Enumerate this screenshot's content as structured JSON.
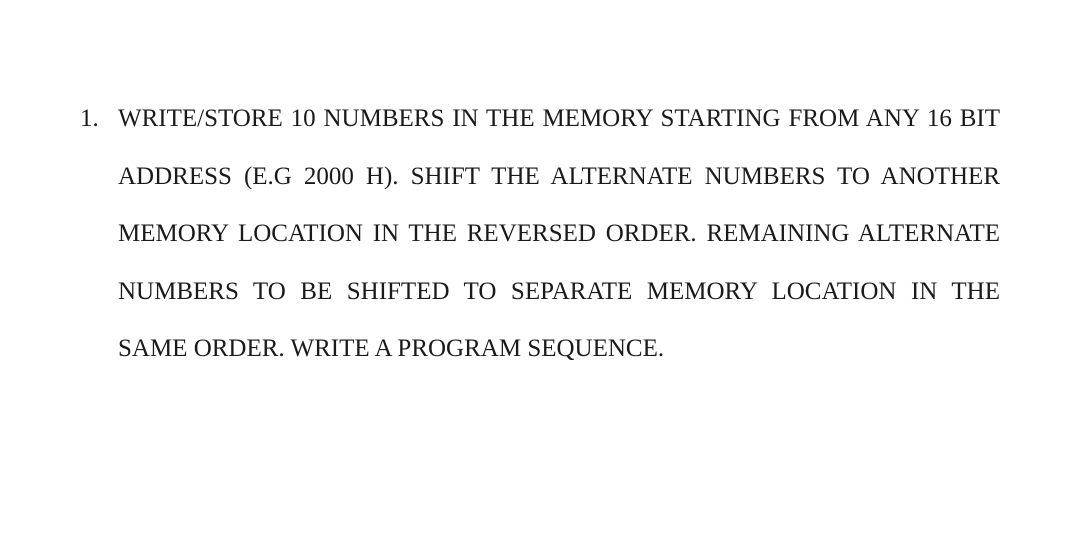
{
  "question": {
    "number": "1.",
    "text": "WRITE/STORE 10 NUMBERS IN THE MEMORY STARTING FROM ANY 16 BIT ADDRESS (E.G 2000 H).  SHIFT THE ALTERNATE NUMBERS TO ANOTHER MEMORY LOCATION IN THE REVERSED ORDER. REMAINING ALTERNATE NUMBERS TO BE SHIFTED TO SEPARATE MEMORY LOCATION IN THE SAME ORDER. WRITE A PROGRAM SEQUENCE."
  }
}
